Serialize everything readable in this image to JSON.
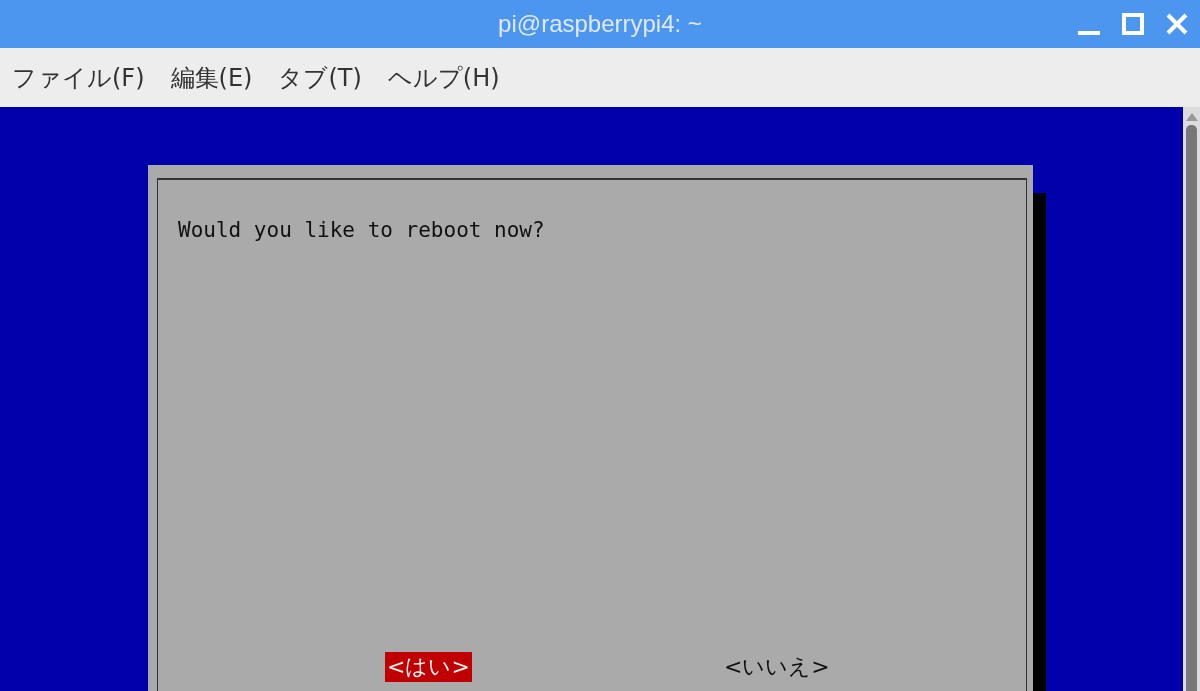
{
  "window": {
    "title": "pi@raspberrypi4: ~"
  },
  "menu": [
    "ファイル(F)",
    "編集(E)",
    "タブ(T)",
    "ヘルプ(H)"
  ],
  "dialog": {
    "message": "Would you like to reboot now?",
    "buttons": [
      {
        "label": "<はい>",
        "selected": true
      },
      {
        "label": "<いいえ>",
        "selected": false
      }
    ]
  }
}
